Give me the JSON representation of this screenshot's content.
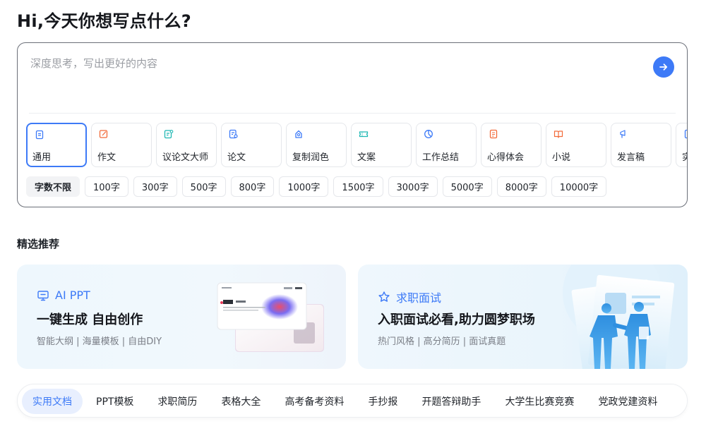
{
  "header": {
    "greeting": "Hi,今天你想写点什么?"
  },
  "compose": {
    "placeholder": "深度思考，写出更好的内容",
    "send_icon": "arrow-right-icon"
  },
  "writing_types": [
    {
      "label": "通用",
      "icon": "document-icon",
      "color": "#3d7af7",
      "active": true
    },
    {
      "label": "作文",
      "icon": "pen-square-icon",
      "color": "#f26b3a"
    },
    {
      "label": "议论文大师",
      "icon": "edit-note-icon",
      "color": "#1fb8b3"
    },
    {
      "label": "论文",
      "icon": "paper-search-icon",
      "color": "#3d7af7"
    },
    {
      "label": "复制润色",
      "icon": "copy-polish-icon",
      "color": "#3d7af7"
    },
    {
      "label": "文案",
      "icon": "ticket-icon",
      "color": "#1fb8b3"
    },
    {
      "label": "工作总结",
      "icon": "pie-chart-icon",
      "color": "#3d7af7"
    },
    {
      "label": "心得体会",
      "icon": "notes-icon",
      "color": "#f26b3a"
    },
    {
      "label": "小说",
      "icon": "book-icon",
      "color": "#f26b3a"
    },
    {
      "label": "发言稿",
      "icon": "microphone-icon",
      "color": "#3d7af7"
    },
    {
      "label": "实",
      "icon": "document-icon",
      "color": "#3d7af7"
    }
  ],
  "word_counts": [
    "字数不限",
    "100字",
    "300字",
    "500字",
    "800字",
    "1000字",
    "1500字",
    "3000字",
    "5000字",
    "8000字",
    "10000字"
  ],
  "recommend": {
    "title": "精选推荐",
    "cards": [
      {
        "tag": "AI PPT",
        "icon": "presentation-icon",
        "title": "一键生成 自由创作",
        "subtitle": "智能大纲 | 海量模板 | 自由DIY"
      },
      {
        "tag": "求职面试",
        "icon": "star-icon",
        "title": "入职面试必看,助力圆梦职场",
        "subtitle": "热门风格 | 高分简历 | 面试真题"
      }
    ]
  },
  "category_tabs": [
    "实用文档",
    "PPT模板",
    "求职简历",
    "表格大全",
    "高考备考资料",
    "手抄报",
    "开题答辩助手",
    "大学生比赛竞赛",
    "党政党建资料"
  ],
  "colors": {
    "accent": "#3d7af7",
    "text": "#1f2329",
    "muted": "#7a7e86"
  }
}
